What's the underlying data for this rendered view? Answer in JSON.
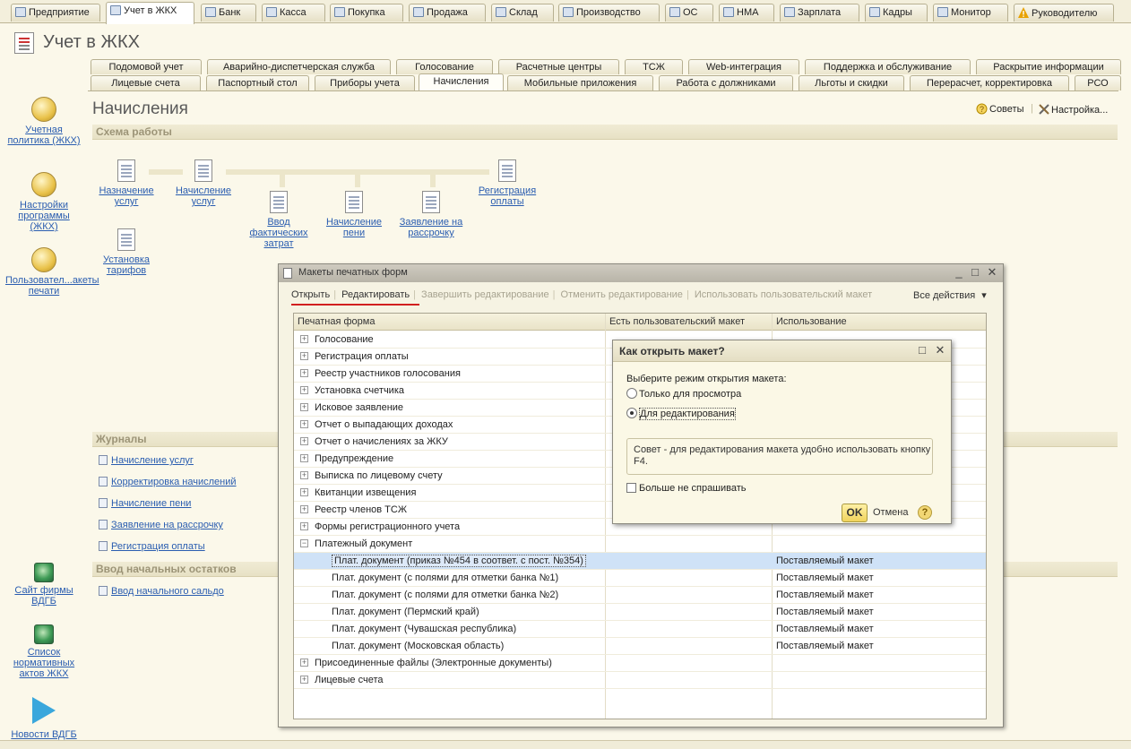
{
  "top_tabs": [
    {
      "label": "Предприятие",
      "icon": "enterprise-icon"
    },
    {
      "label": "Учет в ЖКХ",
      "icon": "document-icon",
      "active": true
    },
    {
      "label": "Банк",
      "icon": "bank-icon"
    },
    {
      "label": "Касса",
      "icon": "cash-icon"
    },
    {
      "label": "Покупка",
      "icon": "purchase-icon"
    },
    {
      "label": "Продажа",
      "icon": "sale-icon"
    },
    {
      "label": "Склад",
      "icon": "warehouse-icon"
    },
    {
      "label": "Производство",
      "icon": "production-icon"
    },
    {
      "label": "ОС",
      "icon": "fixed-assets-icon"
    },
    {
      "label": "НМА",
      "icon": "intangible-icon"
    },
    {
      "label": "Зарплата",
      "icon": "salary-icon"
    },
    {
      "label": "Кадры",
      "icon": "hr-icon"
    },
    {
      "label": "Монитор",
      "icon": "monitor-icon"
    },
    {
      "label": "Руководителю",
      "icon": "warning-icon"
    }
  ],
  "section_title": "Учет в ЖКХ",
  "sub_tabs_row1": [
    "Подомовой учет",
    "Аварийно-диспетчерская служба",
    "Голосование",
    "Расчетные центры",
    "ТСЖ",
    "Web-интеграция",
    "Поддержка и обслуживание",
    "Раскрытие информации"
  ],
  "sub_tabs_row2": [
    "Лицевые счета",
    "Паспортный стол",
    "Приборы учета",
    "Начисления",
    "Мобильные приложения",
    "Работа с должниками",
    "Льготы и скидки",
    "Перерасчет, корректировка",
    "РСО"
  ],
  "active_sub_tab": "Начисления",
  "left_panel": {
    "items": [
      "Учетная политика (ЖКХ)",
      "Настройки программы (ЖКХ)",
      "Пользовател...акеты печати",
      "Сайт фирмы ВДГБ",
      "Список нормативных актов ЖКХ",
      "Новости ВДГБ"
    ]
  },
  "page_heading": "Начисления",
  "tools": {
    "tips": "Советы",
    "settings": "Настройка..."
  },
  "scheme": {
    "title": "Схема работы",
    "nodes": [
      "Назначение услуг",
      "Начисление услуг",
      "Ввод фактических затрат",
      "Начисление пени",
      "Заявление на рассрочку",
      "Регистрация оплаты",
      "Установка тарифов"
    ]
  },
  "journals": {
    "title": "Журналы",
    "items": [
      "Начисление услуг",
      "Корректировка начислений",
      "Начисление пени",
      "Заявление на рассрочку",
      "Регистрация оплаты"
    ]
  },
  "initial_balances": {
    "title": "Ввод начальных остатков",
    "items": [
      "Ввод начального сальдо"
    ]
  },
  "print_forms_dialog": {
    "title": "Макеты печатных форм",
    "toolbar": {
      "open": "Открыть",
      "edit": "Редактировать",
      "finish": "Завершить редактирование",
      "cancel": "Отменить редактирование",
      "use_custom": "Использовать пользовательский макет",
      "all_actions": "Все действия"
    },
    "columns": [
      "Печатная форма",
      "Есть пользовательский макет",
      "Использование"
    ],
    "rows": [
      {
        "name": "Голосование",
        "level": 0,
        "toggle": "+",
        "usage": ""
      },
      {
        "name": "Регистрация оплаты",
        "level": 0,
        "toggle": "+",
        "usage": ""
      },
      {
        "name": "Реестр участников голосования",
        "level": 0,
        "toggle": "+",
        "usage": ""
      },
      {
        "name": "Установка счетчика",
        "level": 0,
        "toggle": "+",
        "usage": ""
      },
      {
        "name": "Исковое заявление",
        "level": 0,
        "toggle": "+",
        "usage": ""
      },
      {
        "name": "Отчет о выпадающих доходах",
        "level": 0,
        "toggle": "+",
        "usage": ""
      },
      {
        "name": "Отчет о начислениях за ЖКУ",
        "level": 0,
        "toggle": "+",
        "usage": ""
      },
      {
        "name": "Предупреждение",
        "level": 0,
        "toggle": "+",
        "usage": ""
      },
      {
        "name": "Выписка по лицевому счету",
        "level": 0,
        "toggle": "+",
        "usage": ""
      },
      {
        "name": "Квитанции извещения",
        "level": 0,
        "toggle": "+",
        "usage": ""
      },
      {
        "name": "Реестр членов ТСЖ",
        "level": 0,
        "toggle": "+",
        "usage": ""
      },
      {
        "name": "Формы регистрационного учета",
        "level": 0,
        "toggle": "+",
        "usage": ""
      },
      {
        "name": "Платежный документ",
        "level": 0,
        "toggle": "−",
        "usage": ""
      },
      {
        "name": "Плат. документ (приказ №454 в соответ. с пост. №354)",
        "level": 1,
        "toggle": "",
        "usage": "Поставляемый макет",
        "selected": true
      },
      {
        "name": "Плат. документ (с полями для отметки банка №1)",
        "level": 1,
        "toggle": "",
        "usage": "Поставляемый макет"
      },
      {
        "name": "Плат. документ (с полями для отметки банка №2)",
        "level": 1,
        "toggle": "",
        "usage": "Поставляемый макет"
      },
      {
        "name": "Плат. документ (Пермский край)",
        "level": 1,
        "toggle": "",
        "usage": "Поставляемый макет"
      },
      {
        "name": "Плат. документ (Чувашская республика)",
        "level": 1,
        "toggle": "",
        "usage": "Поставляемый макет"
      },
      {
        "name": "Плат. документ (Московская область)",
        "level": 1,
        "toggle": "",
        "usage": "Поставляемый макет"
      },
      {
        "name": "Присоединенные файлы (Электронные документы)",
        "level": 0,
        "toggle": "+",
        "usage": ""
      },
      {
        "name": "Лицевые счета",
        "level": 0,
        "toggle": "+",
        "usage": ""
      }
    ]
  },
  "open_dialog": {
    "title": "Как открыть макет?",
    "prompt": "Выберите режим открытия макета:",
    "option_view": "Только для просмотра",
    "option_edit": "Для редактирования",
    "selected_option": "Для редактирования",
    "hint": "Совет - для редактирования макета удобно использовать кнопку F4.",
    "dont_ask": "Больше не спрашивать",
    "ok": "OK",
    "cancel": "Отмена",
    "help": "?"
  }
}
